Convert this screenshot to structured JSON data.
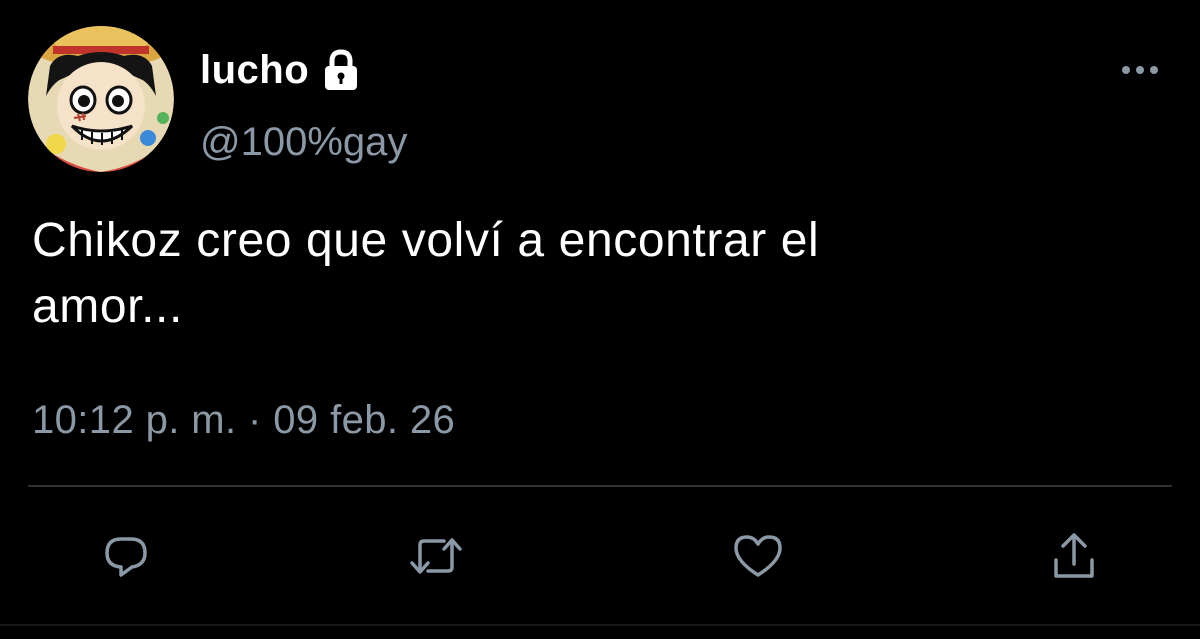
{
  "author": {
    "display_name": "lucho",
    "handle": "@100%gay",
    "protected_icon": "lock-icon",
    "avatar_icon": "avatar-cartoon"
  },
  "tweet": {
    "text_line1": "Chikoz creo que volví a encontrar el",
    "text_line2": "amor...",
    "timestamp": "10:12 p. m. · 09 feb. 26"
  },
  "actions": {
    "reply_icon": "reply-icon",
    "retweet_icon": "retweet-icon",
    "like_icon": "heart-icon",
    "share_icon": "share-icon",
    "more_icon": "more-dots-icon"
  },
  "colors": {
    "background": "#000000",
    "primary_text": "#ffffff",
    "secondary_text": "#8b98a5",
    "divider": "#2f3336"
  }
}
